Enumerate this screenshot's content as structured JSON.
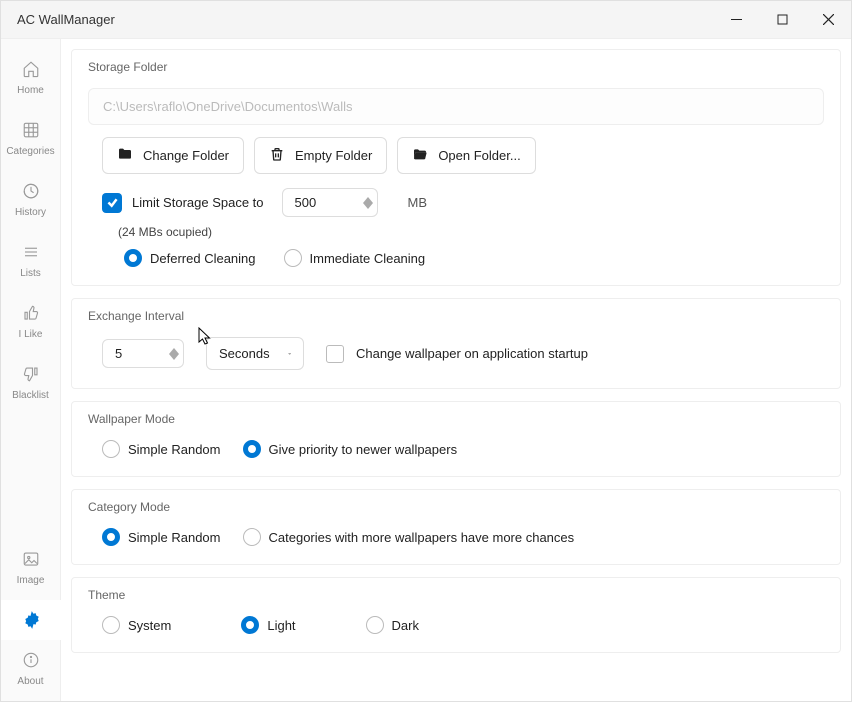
{
  "window": {
    "title": "AC WallManager"
  },
  "sidebar": {
    "items": [
      {
        "label": "Home"
      },
      {
        "label": "Categories"
      },
      {
        "label": "History"
      },
      {
        "label": "Lists"
      },
      {
        "label": "I Like"
      },
      {
        "label": "Blacklist"
      }
    ],
    "bottom": [
      {
        "label": "Image"
      },
      {
        "label": ""
      },
      {
        "label": "About"
      }
    ]
  },
  "storage": {
    "title": "Storage Folder",
    "path": "C:\\Users\\raflo\\OneDrive\\Documentos\\Walls",
    "change": "Change Folder",
    "empty": "Empty Folder",
    "open": "Open Folder...",
    "limit_label": "Limit Storage Space to",
    "limit_value": "500",
    "limit_unit": "MB",
    "occupied": "(24 MBs ocupied)",
    "radio_deferred": "Deferred Cleaning",
    "radio_immediate": "Immediate Cleaning"
  },
  "interval": {
    "title": "Exchange Interval",
    "value": "5",
    "unit": "Seconds",
    "startup": "Change wallpaper on application startup"
  },
  "wallmode": {
    "title": "Wallpaper Mode",
    "simple": "Simple Random",
    "priority": "Give priority to newer wallpapers"
  },
  "catmode": {
    "title": "Category Mode",
    "simple": "Simple Random",
    "weighted": "Categories with more wallpapers have more chances"
  },
  "theme": {
    "title": "Theme",
    "system": "System",
    "light": "Light",
    "dark": "Dark"
  }
}
